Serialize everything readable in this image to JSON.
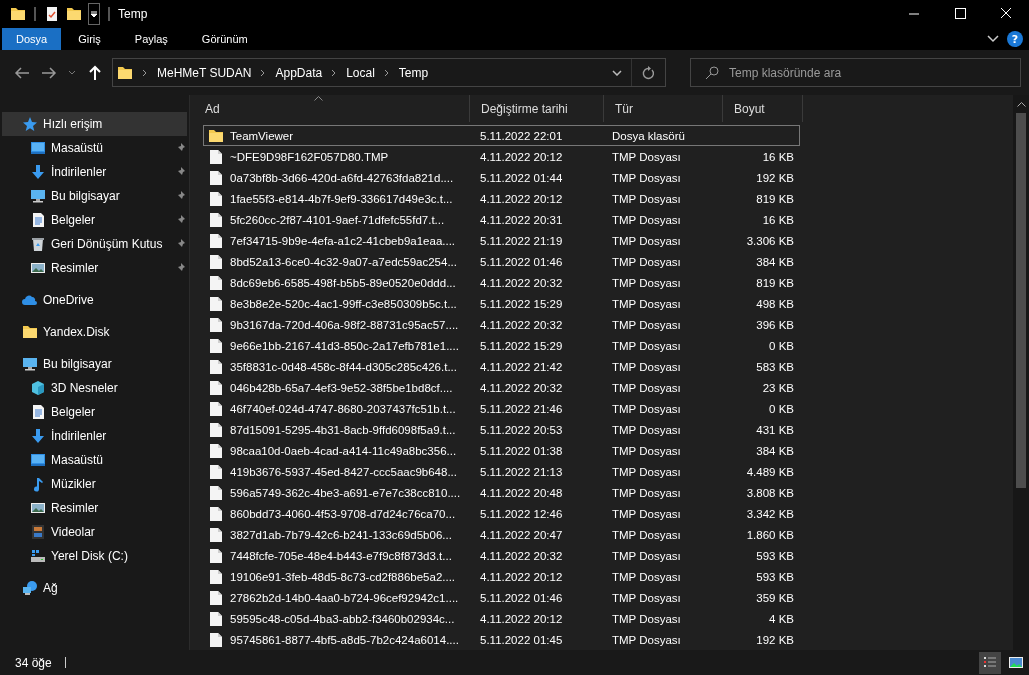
{
  "window": {
    "title": "Temp"
  },
  "ribbon": {
    "tabs": [
      {
        "label": "Dosya",
        "selected": true
      },
      {
        "label": "Giriş",
        "selected": false
      },
      {
        "label": "Paylaş",
        "selected": false
      },
      {
        "label": "Görünüm",
        "selected": false
      }
    ],
    "help": "?"
  },
  "address": {
    "path": [
      "MeHMeT SUDAN",
      "AppData",
      "Local",
      "Temp"
    ],
    "search": {
      "placeholder": "Temp klasöründe ara"
    }
  },
  "sidebar": {
    "items": [
      {
        "label": "Hızlı erişim",
        "kind": "star",
        "selected": true,
        "children": [
          {
            "label": "Masaüstü",
            "kind": "desktop",
            "pinned": true,
            "selected": false
          },
          {
            "label": "İndirilenler",
            "kind": "download",
            "pinned": true,
            "selected": false
          },
          {
            "label": "Bu bilgisayar",
            "kind": "pc",
            "pinned": true,
            "selected": false
          },
          {
            "label": "Belgeler",
            "kind": "docs",
            "pinned": true,
            "selected": false
          },
          {
            "label": "Geri Dönüşüm Kutus",
            "kind": "recycle",
            "pinned": true,
            "selected": false
          },
          {
            "label": "Resimler",
            "kind": "pictures",
            "pinned": true,
            "selected": false
          }
        ]
      },
      {
        "label": "OneDrive",
        "kind": "cloud",
        "selected": false
      },
      {
        "label": "Yandex.Disk",
        "kind": "folder",
        "selected": false
      },
      {
        "label": "Bu bilgisayar",
        "kind": "pc",
        "selected": false,
        "children": [
          {
            "label": "3D Nesneler",
            "kind": "cube",
            "selected": false
          },
          {
            "label": "Belgeler",
            "kind": "docs",
            "selected": false
          },
          {
            "label": "İndirilenler",
            "kind": "download",
            "selected": false
          },
          {
            "label": "Masaüstü",
            "kind": "desktop",
            "selected": false
          },
          {
            "label": "Müzikler",
            "kind": "music",
            "selected": false
          },
          {
            "label": "Resimler",
            "kind": "pictures",
            "selected": false
          },
          {
            "label": "Videolar",
            "kind": "video",
            "selected": false
          },
          {
            "label": "Yerel Disk (C:)",
            "kind": "drive",
            "selected": false
          }
        ]
      },
      {
        "label": "Ağ",
        "kind": "network",
        "selected": false
      }
    ]
  },
  "table": {
    "columns": [
      "Ad",
      "Değiştirme tarihi",
      "Tür",
      "Boyut"
    ],
    "rows": [
      {
        "kind": "folder",
        "selected": true,
        "name": "TeamViewer",
        "date": "5.11.2022 22:01",
        "type": "Dosya klasörü",
        "size": ""
      },
      {
        "kind": "file",
        "selected": false,
        "name": "~DFE9D98F162F057D80.TMP",
        "date": "4.11.2022 20:12",
        "type": "TMP Dosyası",
        "size": "16 KB"
      },
      {
        "kind": "file",
        "selected": false,
        "name": "0a73bf8b-3d66-420d-a6fd-42763fda821d....",
        "date": "5.11.2022 01:44",
        "type": "TMP Dosyası",
        "size": "192 KB"
      },
      {
        "kind": "file",
        "selected": false,
        "name": "1fae55f3-e814-4b7f-9ef9-336617d49e3c.t...",
        "date": "4.11.2022 20:12",
        "type": "TMP Dosyası",
        "size": "819 KB"
      },
      {
        "kind": "file",
        "selected": false,
        "name": "5fc260cc-2f87-4101-9aef-71dfefc55fd7.t...",
        "date": "4.11.2022 20:31",
        "type": "TMP Dosyası",
        "size": "16 KB"
      },
      {
        "kind": "file",
        "selected": false,
        "name": "7ef34715-9b9e-4efa-a1c2-41cbeb9a1eaa....",
        "date": "5.11.2022 21:19",
        "type": "TMP Dosyası",
        "size": "3.306 KB"
      },
      {
        "kind": "file",
        "selected": false,
        "name": "8bd52a13-6ce0-4c32-9a07-a7edc59ac254...",
        "date": "5.11.2022 01:46",
        "type": "TMP Dosyası",
        "size": "384 KB"
      },
      {
        "kind": "file",
        "selected": false,
        "name": "8dc69eb6-6585-498f-b5b5-89e0520e0ddd...",
        "date": "4.11.2022 20:32",
        "type": "TMP Dosyası",
        "size": "819 KB"
      },
      {
        "kind": "file",
        "selected": false,
        "name": "8e3b8e2e-520c-4ac1-99ff-c3e850309b5c.t...",
        "date": "5.11.2022 15:29",
        "type": "TMP Dosyası",
        "size": "498 KB"
      },
      {
        "kind": "file",
        "selected": false,
        "name": "9b3167da-720d-406a-98f2-88731c95ac57....",
        "date": "4.11.2022 20:32",
        "type": "TMP Dosyası",
        "size": "396 KB"
      },
      {
        "kind": "file",
        "selected": false,
        "name": "9e66e1bb-2167-41d3-850c-2a17efb781e1....",
        "date": "5.11.2022 15:29",
        "type": "TMP Dosyası",
        "size": "0 KB"
      },
      {
        "kind": "file",
        "selected": false,
        "name": "35f8831c-0d48-458c-8f44-d305c285c426.t...",
        "date": "4.11.2022 21:42",
        "type": "TMP Dosyası",
        "size": "583 KB"
      },
      {
        "kind": "file",
        "selected": false,
        "name": "046b428b-65a7-4ef3-9e52-38f5be1bd8cf....",
        "date": "4.11.2022 20:32",
        "type": "TMP Dosyası",
        "size": "23 KB"
      },
      {
        "kind": "file",
        "selected": false,
        "name": "46f740ef-024d-4747-8680-2037437fc51b.t...",
        "date": "5.11.2022 21:46",
        "type": "TMP Dosyası",
        "size": "0 KB"
      },
      {
        "kind": "file",
        "selected": false,
        "name": "87d15091-5295-4b31-8acb-9ffd6098f5a9.t...",
        "date": "5.11.2022 20:53",
        "type": "TMP Dosyası",
        "size": "431 KB"
      },
      {
        "kind": "file",
        "selected": false,
        "name": "98caa10d-0aeb-4cad-a414-11c49a8bc356...",
        "date": "5.11.2022 01:38",
        "type": "TMP Dosyası",
        "size": "384 KB"
      },
      {
        "kind": "file",
        "selected": false,
        "name": "419b3676-5937-45ed-8427-ccc5aac9b648...",
        "date": "5.11.2022 21:13",
        "type": "TMP Dosyası",
        "size": "4.489 KB"
      },
      {
        "kind": "file",
        "selected": false,
        "name": "596a5749-362c-4be3-a691-e7e7c38cc810....",
        "date": "4.11.2022 20:48",
        "type": "TMP Dosyası",
        "size": "3.808 KB"
      },
      {
        "kind": "file",
        "selected": false,
        "name": "860bdd73-4060-4f53-9708-d7d24c76ca70...",
        "date": "5.11.2022 12:46",
        "type": "TMP Dosyası",
        "size": "3.342 KB"
      },
      {
        "kind": "file",
        "selected": false,
        "name": "3827d1ab-7b79-42c6-b241-133c69d5b06...",
        "date": "4.11.2022 20:47",
        "type": "TMP Dosyası",
        "size": "1.860 KB"
      },
      {
        "kind": "file",
        "selected": false,
        "name": "7448fcfe-705e-48e4-b443-e7f9c8f873d3.t...",
        "date": "4.11.2022 20:32",
        "type": "TMP Dosyası",
        "size": "593 KB"
      },
      {
        "kind": "file",
        "selected": false,
        "name": "19106e91-3feb-48d5-8c73-cd2f886be5a2....",
        "date": "4.11.2022 20:12",
        "type": "TMP Dosyası",
        "size": "593 KB"
      },
      {
        "kind": "file",
        "selected": false,
        "name": "27862b2d-14b0-4aa0-b724-96cef92942c1....",
        "date": "5.11.2022 01:46",
        "type": "TMP Dosyası",
        "size": "359 KB"
      },
      {
        "kind": "file",
        "selected": false,
        "name": "59595c48-c05d-4ba3-abb2-f3460b02934c...",
        "date": "4.11.2022 20:12",
        "type": "TMP Dosyası",
        "size": "4 KB"
      },
      {
        "kind": "file",
        "selected": false,
        "name": "95745861-8877-4bf5-a8d5-7b2c424a6014....",
        "date": "5.11.2022 01:45",
        "type": "TMP Dosyası",
        "size": "192 KB"
      }
    ]
  },
  "status_bar": {
    "count": "34 öğe",
    "views": [
      {
        "kind": "details",
        "selected": true
      },
      {
        "kind": "large-icons",
        "selected": false
      }
    ]
  }
}
